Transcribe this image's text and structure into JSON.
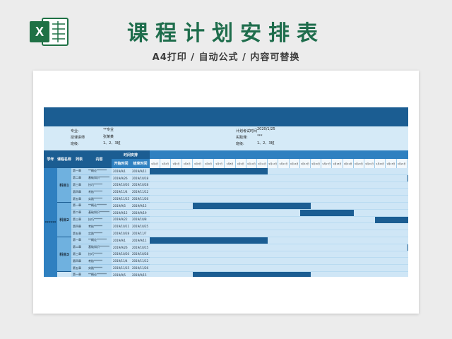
{
  "header": {
    "title": "课程计划安排表",
    "subtitle": "A4打印 / 自动公式 / 内容可替换",
    "logo_letter": "X"
  },
  "info": {
    "major_label": "专业:",
    "major_value": "**专业",
    "teacher_label": "授课讲师",
    "teacher_value": "张某某",
    "class_label": "班级:",
    "class_value": "1、2、3班",
    "plan_label": "计划考试时间",
    "plan_value": "2020/1/25",
    "hours_label": "实践课:",
    "hours_value": "***",
    "class2_label": "班级:",
    "class2_value": "1、2、3班"
  },
  "columns": {
    "semester": "学年",
    "course": "课程名称",
    "chapter": "列表",
    "content": "内容",
    "time_group": "时间安排",
    "start": "开始时间",
    "end": "结束时间"
  },
  "semester_value": "******",
  "day_labels": [
    "9月1日",
    "9月2日",
    "9月3日",
    "9月4日",
    "9月5日",
    "9月6日",
    "9月7日",
    "9月8日",
    "9月9日",
    "9月10日",
    "9月11日",
    "9月12日",
    "9月13日",
    "9月14日",
    "9月15日",
    "9月16日",
    "9月17日",
    "9月18日",
    "9月19日",
    "9月20日",
    "9月21日",
    "9月22日",
    "9月23日",
    "9月24日",
    "9月25日"
  ],
  "groups": [
    {
      "name": "科目1"
    },
    {
      "name": "科目2"
    },
    {
      "name": "科目3"
    }
  ],
  "rows": [
    {
      "chapter": "第一章",
      "content": "**概论*******",
      "start": "2019/9/1",
      "end": "2019/9/11",
      "bar_start": 0,
      "bar_len": 11
    },
    {
      "chapter": "第二章",
      "content": "基础知识*******",
      "start": "2019/9/26",
      "end": "2019/10/18",
      "bar_start": 24,
      "bar_len": 1
    },
    {
      "chapter": "第三章",
      "content": "技巧******",
      "start": "2019/10/20",
      "end": "2019/10/28",
      "bar_start": null,
      "bar_len": 0
    },
    {
      "chapter": "第四章",
      "content": "考核******",
      "start": "2019/11/4",
      "end": "2019/11/12",
      "bar_start": null,
      "bar_len": 0
    },
    {
      "chapter": "第五章",
      "content": "实践******",
      "start": "2019/11/15",
      "end": "2019/11/26",
      "bar_start": null,
      "bar_len": 0
    },
    {
      "chapter": "第一章",
      "content": "**概论*******",
      "start": "2019/9/5",
      "end": "2019/9/15",
      "bar_start": 4,
      "bar_len": 11
    },
    {
      "chapter": "第二章",
      "content": "基础知识*******",
      "start": "2019/9/15",
      "end": "2019/9/19",
      "bar_start": 14,
      "bar_len": 5
    },
    {
      "chapter": "第三章",
      "content": "技巧******",
      "start": "2019/9/22",
      "end": "2019/10/8",
      "bar_start": 21,
      "bar_len": 4
    },
    {
      "chapter": "第四章",
      "content": "考核******",
      "start": "2019/10/11",
      "end": "2019/10/25",
      "bar_start": null,
      "bar_len": 0
    },
    {
      "chapter": "第五章",
      "content": "实践******",
      "start": "2019/10/28",
      "end": "2019/11/7",
      "bar_start": null,
      "bar_len": 0
    },
    {
      "chapter": "第一章",
      "content": "**概论*******",
      "start": "2019/9/1",
      "end": "2019/9/11",
      "bar_start": 0,
      "bar_len": 11
    },
    {
      "chapter": "第二章",
      "content": "基础知识*******",
      "start": "2019/9/26",
      "end": "2019/10/15",
      "bar_start": 24,
      "bar_len": 1
    },
    {
      "chapter": "第三章",
      "content": "技巧******",
      "start": "2019/10/20",
      "end": "2019/10/28",
      "bar_start": null,
      "bar_len": 0
    },
    {
      "chapter": "第四章",
      "content": "考核******",
      "start": "2019/11/4",
      "end": "2019/11/12",
      "bar_start": null,
      "bar_len": 0
    },
    {
      "chapter": "第五章",
      "content": "实践******",
      "start": "2019/11/15",
      "end": "2019/11/26",
      "bar_start": null,
      "bar_len": 0
    },
    {
      "chapter": "第一章",
      "content": "**概论*******",
      "start": "2019/9/5",
      "end": "2019/9/15",
      "bar_start": 4,
      "bar_len": 11
    }
  ],
  "colors": {
    "title_green": "#1e6d4c",
    "excel_green": "#1f7145",
    "dark_blue": "#1b5d92",
    "mid_blue": "#2f80c0",
    "light_blue": "#cfe6f6"
  }
}
